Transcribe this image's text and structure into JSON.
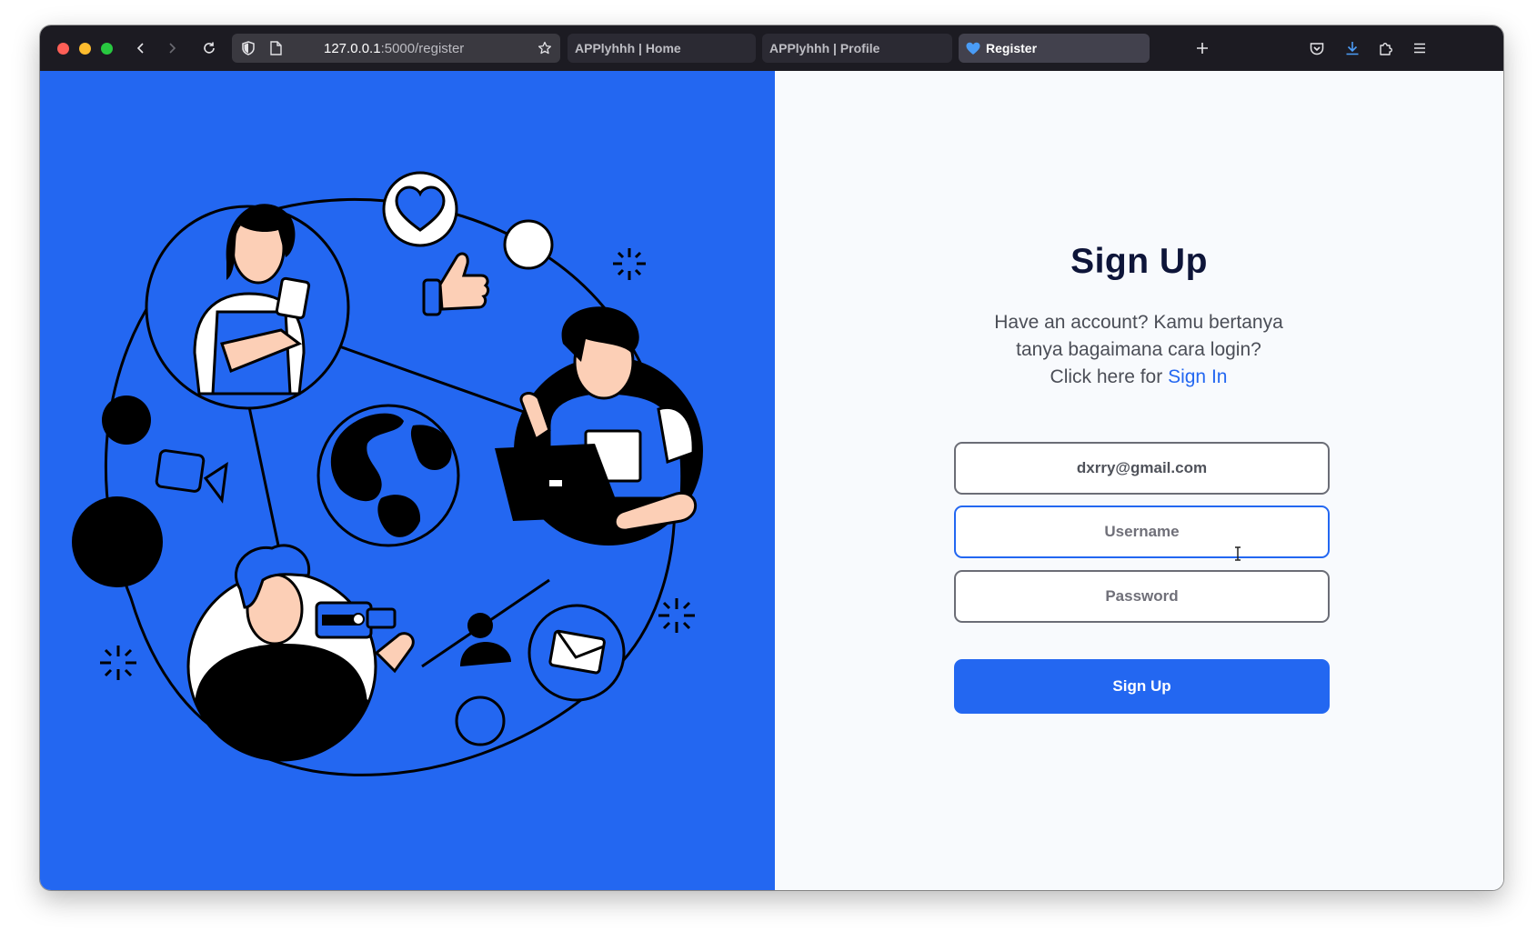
{
  "browser": {
    "url_host": "127.0.0.1",
    "url_rest": ":5000/register",
    "tabs": [
      {
        "label": "APPlyhhh | Home",
        "active": false
      },
      {
        "label": "APPlyhhh | Profile",
        "active": false
      },
      {
        "label": "Register",
        "active": true
      }
    ],
    "icons": [
      "back-icon",
      "forward-icon",
      "reload-icon",
      "shield-icon",
      "page-icon",
      "star-icon",
      "plus-icon",
      "pocket-icon",
      "download-icon",
      "extensions-icon",
      "menu-icon"
    ]
  },
  "illustration": {
    "description_icons": [
      "heart-icon",
      "thumbs-up-icon",
      "globe-icon",
      "laptop-icon",
      "envelope-icon",
      "user-icon",
      "video-camera-icon",
      "sparkle-icon"
    ]
  },
  "form": {
    "title": "Sign Up",
    "subtitle_line1": "Have an account? Kamu bertanya",
    "subtitle_line2": "tanya bagaimana cara login?",
    "subtitle_line3_prefix": "Click here for ",
    "signin_link": "Sign In",
    "email_value": "dxrry@gmail.com",
    "username_placeholder": "Username",
    "password_placeholder": "Password",
    "submit_label": "Sign Up"
  },
  "colors": {
    "accent": "#2367f1",
    "title": "#0e1539",
    "chrome": "#1c1b22"
  }
}
